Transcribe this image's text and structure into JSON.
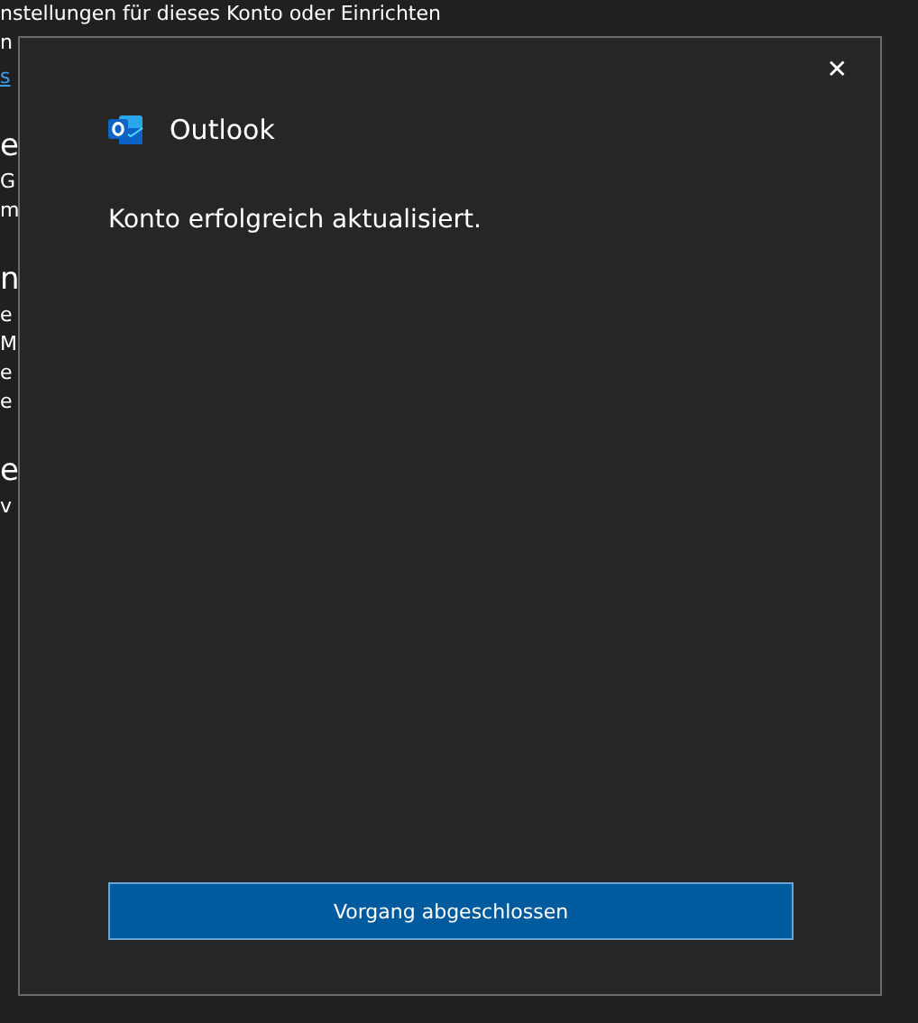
{
  "background_page": {
    "sections": [
      {
        "lines": [
          "nstellungen für dieses Konto oder Einrichten",
          "n"
        ],
        "link": "s"
      },
      {
        "heading": "e",
        "lines": [
          "G",
          "m"
        ]
      },
      {
        "heading": "n",
        "lines": [
          "e",
          "M",
          "e",
          "e"
        ]
      },
      {
        "heading": "e",
        "lines": [
          "v"
        ]
      }
    ]
  },
  "dialog": {
    "app_name": "Outlook",
    "close_label": "✕",
    "message": "Konto erfolgreich aktualisiert.",
    "button": "Vorgang abgeschlossen"
  }
}
